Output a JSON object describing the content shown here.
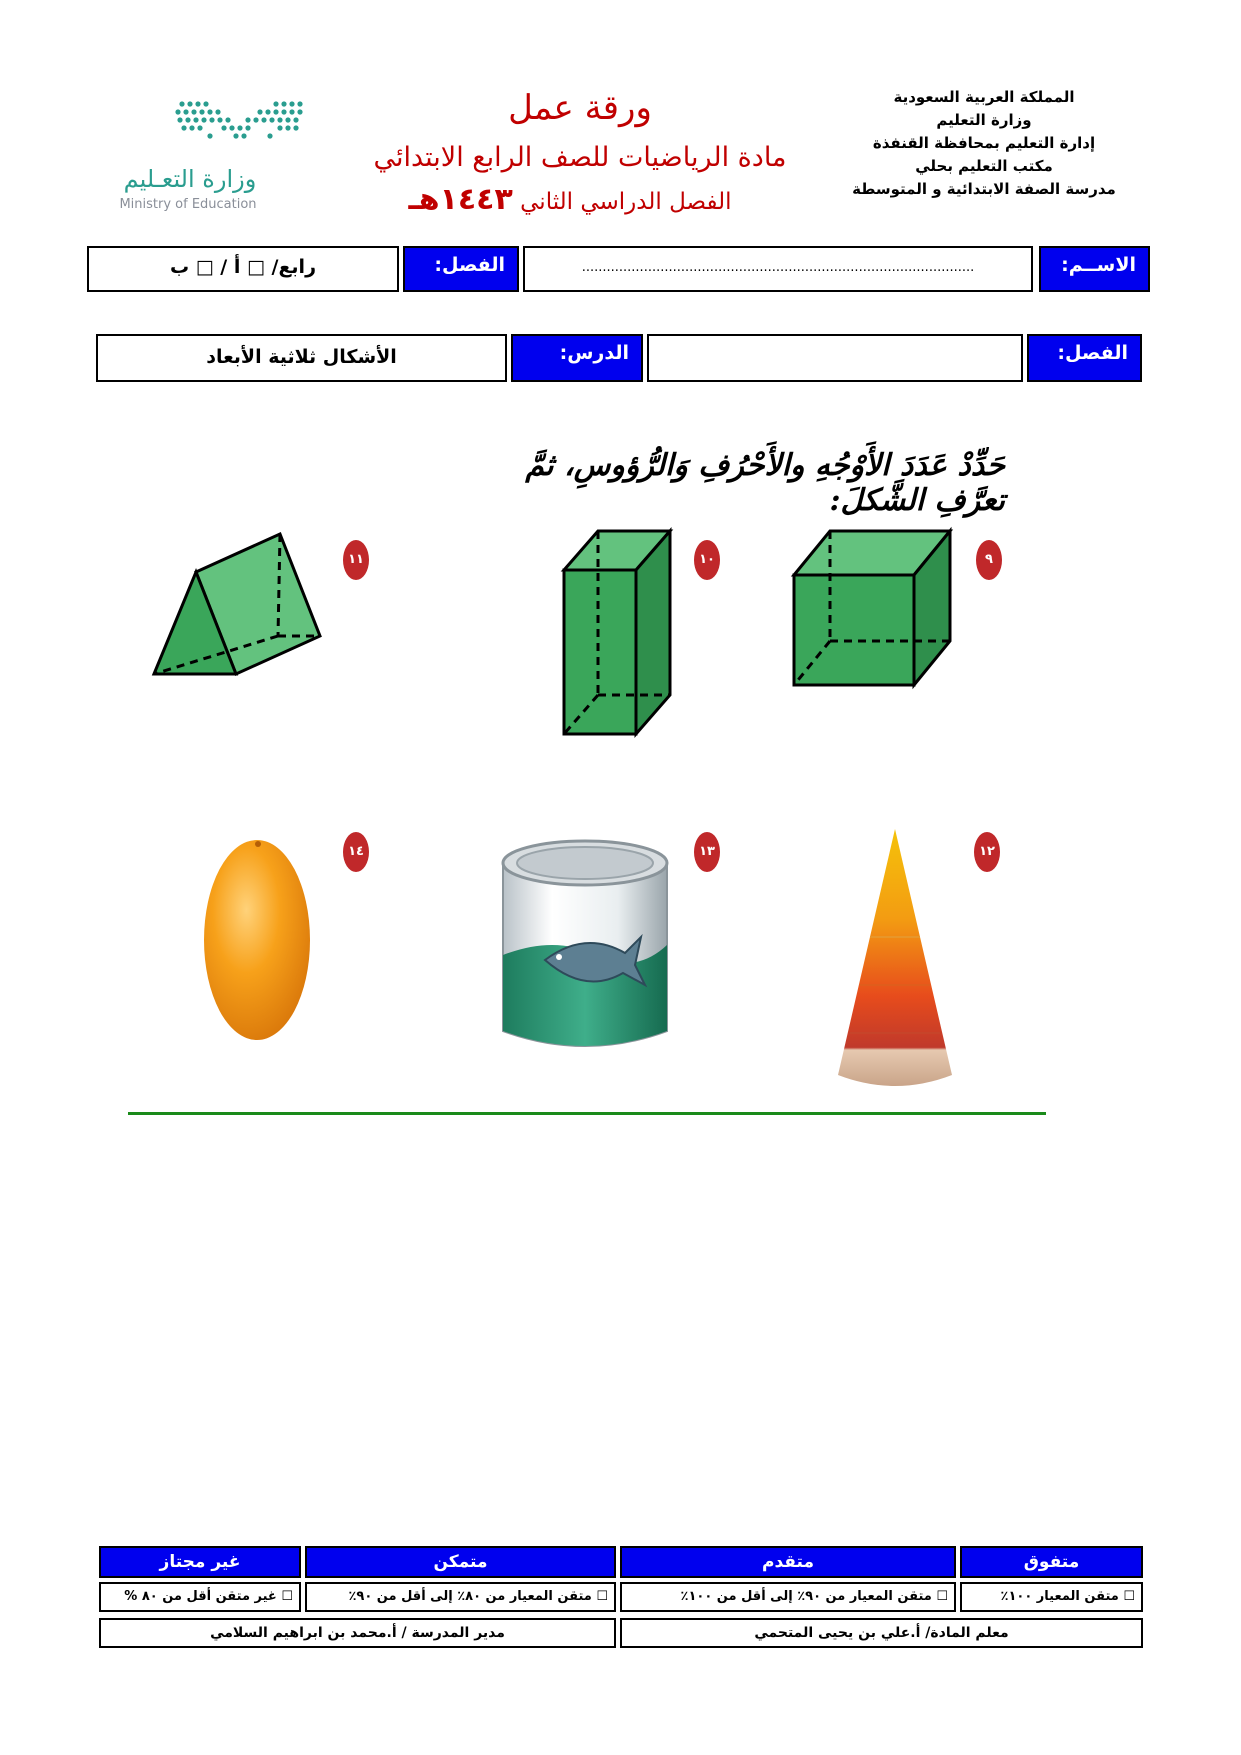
{
  "header": {
    "right_lines": [
      "المملكة العربية السعودية",
      "وزارة التعليم",
      "إدارة التعليم بمحافظة القنفذة",
      "مكتب التعليم بحلي",
      "مدرسة الصفة الابتدائية و المتوسطة"
    ],
    "title": "ورقة عمل",
    "subject": "مادة الرياضيات للصف الرابع الابتدائي",
    "term": "الفصل الدراسي الثاني",
    "year": "١٤٤٣هـ",
    "logo_ar": "وزارة التعـليم",
    "logo_en": "Ministry of Education"
  },
  "row1": {
    "name_label": "الاســم:",
    "name_dots": "...............................................................................................",
    "class_label": "الفصل:",
    "class_value": "رابع/ □ أ  /  □ ب"
  },
  "row2": {
    "class_label": "الفصل:",
    "class_value": "",
    "lesson_label": "الدرس:",
    "lesson_value": "الأشكال ثلاثية الأبعاد"
  },
  "instruction": "حَدِّدْ عَدَدَ الأَوْجُهِ والأَحْرُفِ وَالرُّؤوسِ، ثمَّ تعرَّفِ الشَّكلَ:",
  "problems": [
    {
      "number": "٩",
      "shape": "cube"
    },
    {
      "number": "١٠",
      "shape": "rectangular-prism"
    },
    {
      "number": "١١",
      "shape": "triangular-prism"
    },
    {
      "number": "١٢",
      "shape": "cone"
    },
    {
      "number": "١٣",
      "shape": "cylinder-can"
    },
    {
      "number": "١٤",
      "shape": "sphere-orange"
    }
  ],
  "rubric": {
    "headers": [
      "متفوق",
      "متقدم",
      "متمكن",
      "غير مجتاز"
    ],
    "criteria": [
      "☐ متقن المعيار ١٠٠٪",
      "☐ متقن المعيار من ٩٠٪  إلى أقل من ١٠٠٪",
      "☐ متقن المعيار من ٨٠٪ إلى أقل من ٩٠٪",
      "☐ غير متقن أقل من ٨٠ %"
    ],
    "teacher": "معلم المادة/ أ.علي بن يحيى المتحمي",
    "principal": "مدير المدرسة / أ.محمد بن ابراهيم السلامي"
  },
  "colors": {
    "accent_blue": "#0000ee",
    "title_red": "#c00000",
    "shape_green": "#3aa65a",
    "divider_green": "#1a8a1a"
  }
}
